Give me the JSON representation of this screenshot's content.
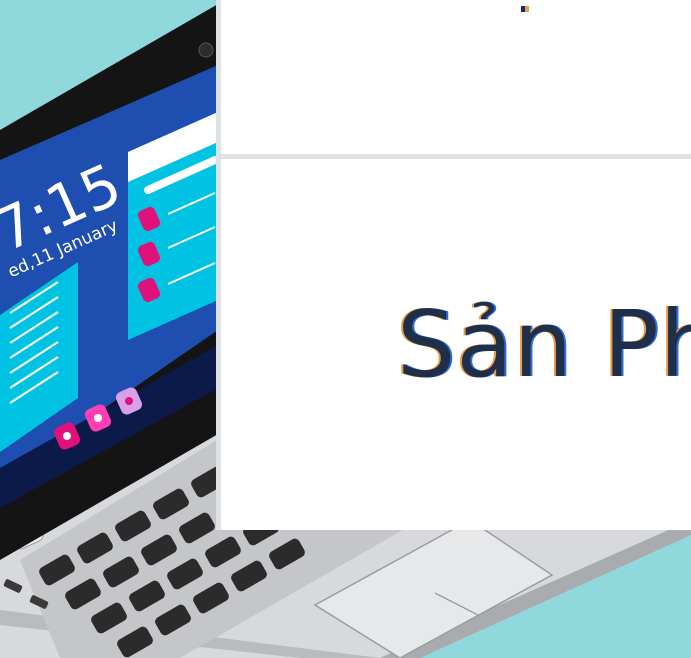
{
  "screen": {
    "time": "7:15",
    "date": "ed,11 January"
  },
  "zoom_panel": {
    "product_text": "Sản Ph"
  },
  "colors": {
    "background": "#8fd9dc",
    "screen_blue": "#1e4fb0",
    "widget_cyan": "#00c3e3",
    "accent_pink": "#e0117a",
    "laptop_silver": "#d5d7da",
    "key_dark": "#2b2b2b"
  }
}
